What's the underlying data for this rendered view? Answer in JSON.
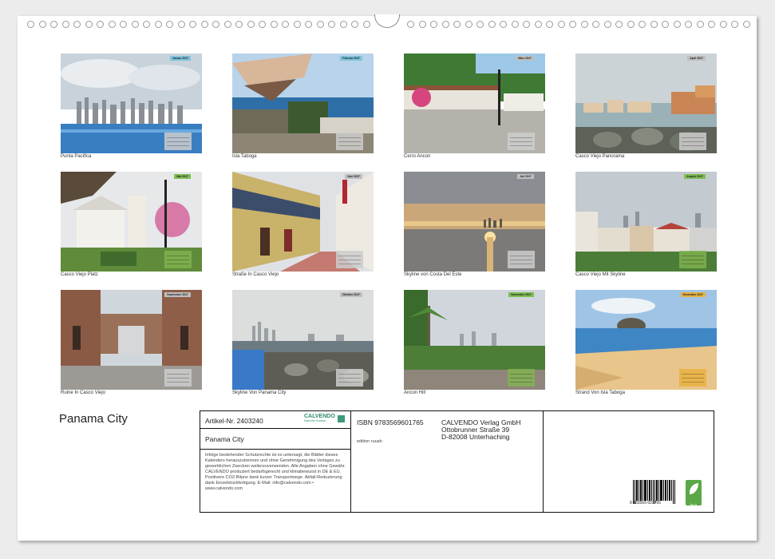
{
  "title": "Panama City",
  "months": [
    {
      "tag": "Januar 2027",
      "caption": "Punta Pacifica",
      "tag_color": "#7fc4dd"
    },
    {
      "tag": "Februar 2027",
      "caption": "Isla Taboga",
      "tag_color": "#7fc4dd"
    },
    {
      "tag": "März 2027",
      "caption": "Cerro Ancon",
      "tag_color": "#bfbfbf"
    },
    {
      "tag": "April 2027",
      "caption": "Casco Viejo Panorama",
      "tag_color": "#bfbfbf"
    },
    {
      "tag": "Mai 2027",
      "caption": "Casco Viejo Platz",
      "tag_color": "#7fbf52"
    },
    {
      "tag": "Juni 2027",
      "caption": "Straße In Casco Viejo",
      "tag_color": "#bfbfbf"
    },
    {
      "tag": "Juli 2027",
      "caption": "Skyline von Costa Del Este",
      "tag_color": "#bfbfbf"
    },
    {
      "tag": "August 2027",
      "caption": "Casco Viejo Mit Skyline",
      "tag_color": "#7fbf52"
    },
    {
      "tag": "September 2027",
      "caption": "Ruine In Casco Viejo",
      "tag_color": "#bfbfbf"
    },
    {
      "tag": "Oktober 2027",
      "caption": "Skyline Von Panama City",
      "tag_color": "#bfbfbf"
    },
    {
      "tag": "November 2027",
      "caption": "Ancon Hill",
      "tag_color": "#7fbf52"
    },
    {
      "tag": "Dezember 2027",
      "caption": "Strand Von Isla Taboga",
      "tag_color": "#e8b040"
    }
  ],
  "info": {
    "article_no": "Artikel-Nr. 2403240",
    "brand": "CALVENDO",
    "brand_sub": "Kalender Kostbar",
    "product_title": "Panama City",
    "legal": "Infolge bestehender Schutzrechte ist es untersagt, die Blätter dieses Kalenders herauszutrennen und ohne Genehmigung des Verlages zu gewerblichen Zwecken weiterzuverwenden. Alle Angaben ohne Gewähr. CALVENDO produziert bedarfsgerecht und klimabewusst in DE & EU. Positivere CO2-Bilanz dank kurzer Transportwege. Abfall-Reduzierung dank Einzelstückfertigung. E-Mail: info@calvendo.com • www.calvendo.com",
    "isbn": "ISBN 9783569601765",
    "edition": "edition ruuah",
    "publisher_name": "CALVENDO Verlag GmbH",
    "publisher_street": "Ottobrunner Straße 39",
    "publisher_city": "D-82008 Unterhaching",
    "barcode_number": "9 783569 601765",
    "badge": "feca"
  }
}
